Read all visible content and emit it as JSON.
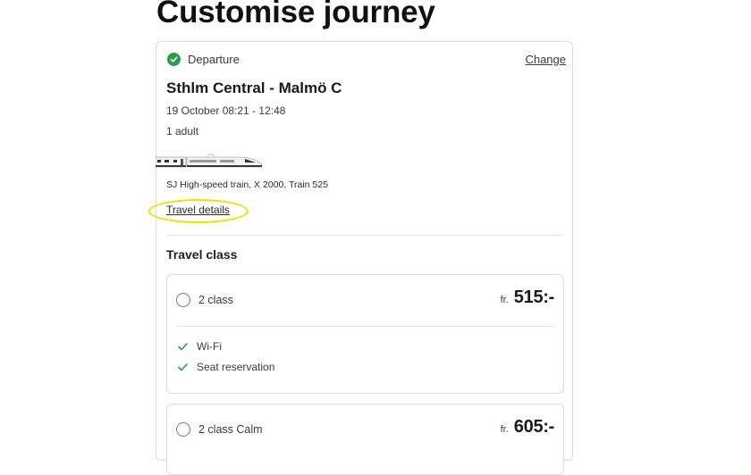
{
  "page": {
    "title": "Customise journey"
  },
  "departure": {
    "label": "Departure",
    "change_label": "Change",
    "route": "Sthlm Central - Malmö C",
    "datetime": "19 October 08:21 - 12:48",
    "passengers": "1 adult",
    "train_description": "SJ High-speed train, X 2000, Train 525",
    "travel_details_label": "Travel details"
  },
  "travel_class": {
    "title": "Travel class",
    "options": [
      {
        "label": "2 class",
        "price_prefix": "fr.",
        "price": "515:-",
        "features": [
          "Wi-Fi",
          "Seat reservation"
        ]
      },
      {
        "label": "2 class Calm",
        "price_prefix": "fr.",
        "price": "605:-"
      }
    ]
  },
  "colors": {
    "success_green": "#2a9d4a",
    "highlight_yellow": "#f0e000",
    "border": "#dcdcdc"
  },
  "icons": {
    "departure_status": "check-circle-icon",
    "feature": "checkmark-icon",
    "train": "train-icon"
  }
}
